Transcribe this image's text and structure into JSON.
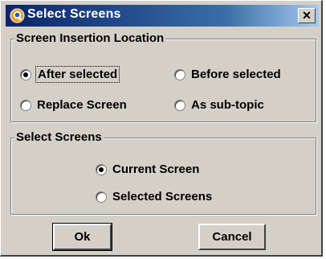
{
  "window": {
    "title": "Select Screens",
    "close_glyph": "✕"
  },
  "insertion": {
    "legend": "Screen Insertion Location",
    "options": [
      {
        "label": "After selected",
        "checked": true
      },
      {
        "label": "Before selected",
        "checked": false
      },
      {
        "label": "Replace Screen",
        "checked": false
      },
      {
        "label": "As sub-topic",
        "checked": false
      }
    ]
  },
  "select": {
    "legend": "Select Screens",
    "options": [
      {
        "label": "Current Screen",
        "checked": true
      },
      {
        "label": "Selected Screens",
        "checked": false
      }
    ]
  },
  "buttons": {
    "ok": "Ok",
    "cancel": "Cancel"
  },
  "colors": {
    "dialog_bg": "#d4d0c8",
    "title_start": "#0a246a",
    "title_end": "#a6caf0"
  }
}
